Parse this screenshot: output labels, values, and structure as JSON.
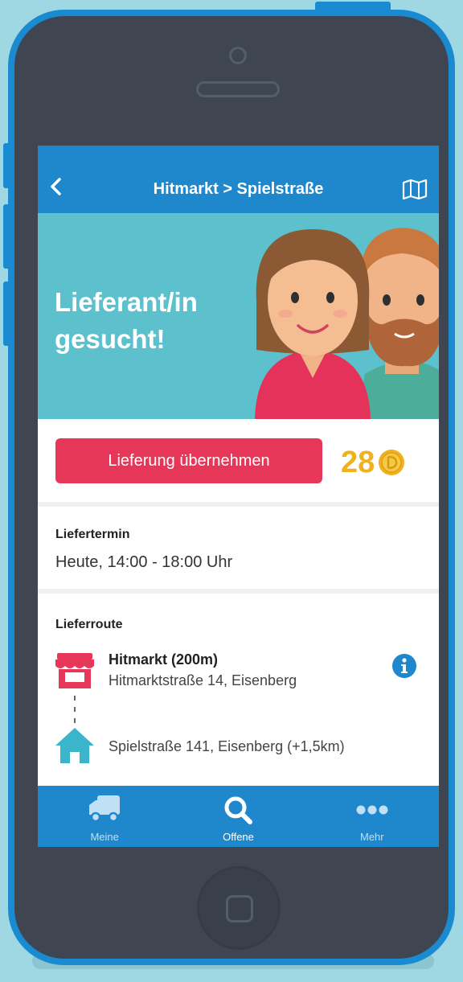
{
  "nav": {
    "title": "Hitmarkt > Spielstraße",
    "back_icon": "chevron-left-icon",
    "map_icon": "map-icon"
  },
  "hero": {
    "headline_line1": "Lieferant/in",
    "headline_line2": "gesucht!",
    "background_color": "#5cc0cd"
  },
  "action": {
    "take_button_label": "Lieferung übernehmen",
    "points": "28",
    "accent_color": "#e63758",
    "points_color": "#f0b21c"
  },
  "termin": {
    "label": "Liefertermin",
    "value": "Heute, 14:00 - 18:00 Uhr"
  },
  "route": {
    "label": "Lieferroute",
    "pickup_name": "Hitmarkt (200m)",
    "pickup_address": "Hitmarktstraße 14, Eisenberg",
    "destination_address": "Spielstraße 141, Eisenberg (+1,5km)"
  },
  "tabbar": {
    "items": [
      {
        "label": "Meine",
        "icon": "truck-icon"
      },
      {
        "label": "Offene",
        "icon": "search-icon",
        "active": true
      },
      {
        "label": "Mehr",
        "icon": "more-dots-icon"
      }
    ]
  }
}
